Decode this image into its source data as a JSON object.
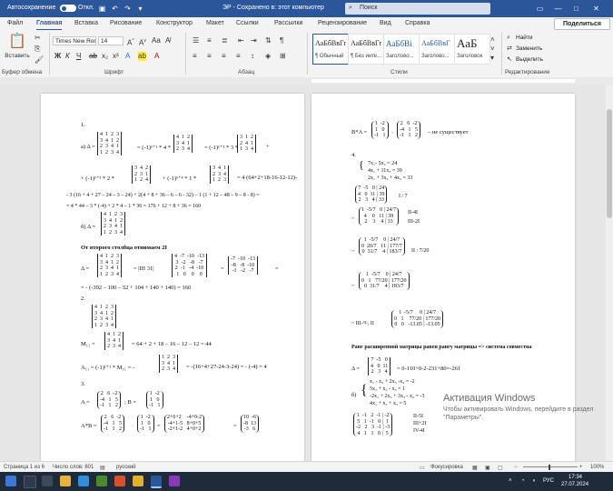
{
  "titlebar": {
    "autosave_label": "Автосохранение",
    "autosave_state": "Откл.",
    "doc_title": "ЭР - Сохранено в: этот компьютер",
    "search_placeholder": "Поиск"
  },
  "tabs": [
    "Файл",
    "Главная",
    "Вставка",
    "Рисование",
    "Конструктор",
    "Макет",
    "Ссылки",
    "Рассылки",
    "Рецензирование",
    "Вид",
    "Справка"
  ],
  "share_label": "Поделиться",
  "ribbon": {
    "clipboard": {
      "paste_label": "Вставить",
      "group_label": "Буфер обмена"
    },
    "font": {
      "font_name": "Times New Ron",
      "font_size": "14",
      "group_label": "Шрифт"
    },
    "paragraph": {
      "group_label": "Абзац"
    },
    "styles": {
      "items": [
        {
          "sample": "АаБбВвГг,",
          "name": "¶ Обычный"
        },
        {
          "sample": "АаБбВвГг,",
          "name": "¶ Без инте..."
        },
        {
          "sample": "АаБбВі",
          "name": "Заголово..."
        },
        {
          "sample": "АаБбВвГ",
          "name": "Заголово..."
        },
        {
          "sample": "АаБ",
          "name": "Заголовок"
        }
      ],
      "group_label": "Стили"
    },
    "editing": {
      "find": "Найти",
      "replace": "Заменить",
      "select": "Выделить",
      "group_label": "Редактирование"
    }
  },
  "page_left": {
    "lines": [
      "1.",
      "а) Δ =",
      "= (-1)¹⁺¹ * 4 *",
      "= (-1)¹⁺³ * 3 *",
      "+ (-1)¹⁺³ * 2 *",
      "+ (-1)¹⁺⁴ * 1 *",
      "= 4 (64+2+18-16-12-12)-",
      "- 3 (16 + 4 + 27 – 24 – 3 – 24) + 2(4 + 8 + 36 – 6 – 6 - 32) – 1 (1 + 12 – 48 – 9 – 8 - 8) =",
      "= 4 * 44 – 3 * (-4) + 2 * 4 – 1 * 36 = 176 + 12 + 8 + 36 = 160",
      "б) Δ =",
      "От второго столбца отнимаем 2I",
      "Δ =",
      "= - (-392 – 100 – 52 + 104 + 140 + 140) = 160",
      "2.",
      "M₁₁ =",
      "= 64 + 2 + 18 – 16 – 12 – 12 = 44",
      "A₁₁ = (-1)¹⁺¹ * M₁₁ = -",
      "= -(16+4+27-24-3-24) = - (-4) = 4",
      "3.",
      "A =",
      "; B =",
      "A*B ="
    ],
    "matrices": {
      "m1": "4  1  2  3\n3  4  1  2\n2  3  4  1\n1  2  3  4",
      "m2": "4  1  2\n3  4  1\n2  3  4",
      "m3": "3  1  2\n2  4  1\n1  3  4",
      "m4": "3  4  2\n2  3  1\n1  2  4",
      "m5": "3  4  1\n2  3  4\n1  2  3",
      "m6": "4  -7  -10  -13\n3  -2   -8   -7\n2  -1   -4  -10\n1   0    0    0",
      "m7": "-7  -10  -13\n-8   -8  -10\n-1   -2   -7",
      "m8": "4  1  2\n3  4  1\n2  3  4",
      "m9": "1  2  3\n3  4  1\n2  3  4",
      "mA": "2   6  -2\n-4   1   5\n-1   1   2",
      "mB": "1  -2\n1   0\n-1   1",
      "mAB1": "2   6  -2\n-4   1   5\n-1   1   2",
      "mAB2": "1  -2\n1   0\n-1   1",
      "mAB3": "2+6+2    -4+0-2\n-4+1-5   8+0+5\n-2+1-2   4+0+2",
      "mAB4": "10  -6\n-8  13\n-3   6"
    }
  },
  "page_right": {
    "lines": [
      "B*A =",
      "– не существует",
      "4.",
      "7x₁- 5x₂ = 24",
      "4x₁ + 11x₃ = 39",
      "2x₁ + 3x₂ + 4x₃ = 33",
      "I / 7",
      "II-4I",
      "III-2I",
      "II : 7/20",
      "~ III-³¹⁄₇ II",
      "Ранг расширенной матрицы равен рангу матрицы => система совместна",
      "Δ =",
      "= 0-110+0-2-231+80=-261",
      "б)",
      "x₁ - x₂ + 2x₃ -x₄ = -2",
      "5x₁ + x₂ - x₃ = 1",
      "-2x₁ + 2x₂ + 3x₃ - x₄ = -3",
      "4x₁ + x₂ + x₃ = 5",
      "II-5I",
      "III+2I",
      "IV-4I"
    ],
    "matrices": {
      "r1": "1  -2\n1   0\n-1   1",
      "r2": "2   6  -2\n-4   1   5\n-1   1   2",
      "r3": "7  -5   0 | 24\n4   0  11 | 39\n2   3   4 | 33",
      "r4": "1  -5/7   0 | 24/7\n4    0   11 | 39\n2    3    4 | 33",
      "r5": "1  -5/7    0 | 24/7\n0  20/7   11 | 177/7\n0  31/7    4 | 183/7",
      "r6": "1  -5/7    0 | 24/7\n0   1   77/20 | 177/20\n0  31/7    4 | 183/7",
      "r7": "1  -5/7     0 | 24/7\n0   1    77/20 | 177/20\n0   0   -13.05 | -13.05",
      "r8": "7  -5   0\n4   0  11\n2   3   4",
      "r9": "1  -1   2  -1 | -2\n5   1  -1   0 |  1\n-2   2   3  -1 | -3\n4   1   1   0 |  5"
    }
  },
  "watermark": {
    "title": "Активация Windows",
    "text": "Чтобы активировать Windows, перейдите в раздел \"Параметры\"."
  },
  "statusbar": {
    "page": "Страница 1 из 6",
    "words": "Число слов: 601",
    "lang": "русский",
    "focus": "Фокусировка",
    "zoom": "100%"
  },
  "taskbar": {
    "lang": "РУС",
    "time": "17:34",
    "date": "27.07.2024"
  },
  "colors": {
    "accent": "#2b579a"
  }
}
